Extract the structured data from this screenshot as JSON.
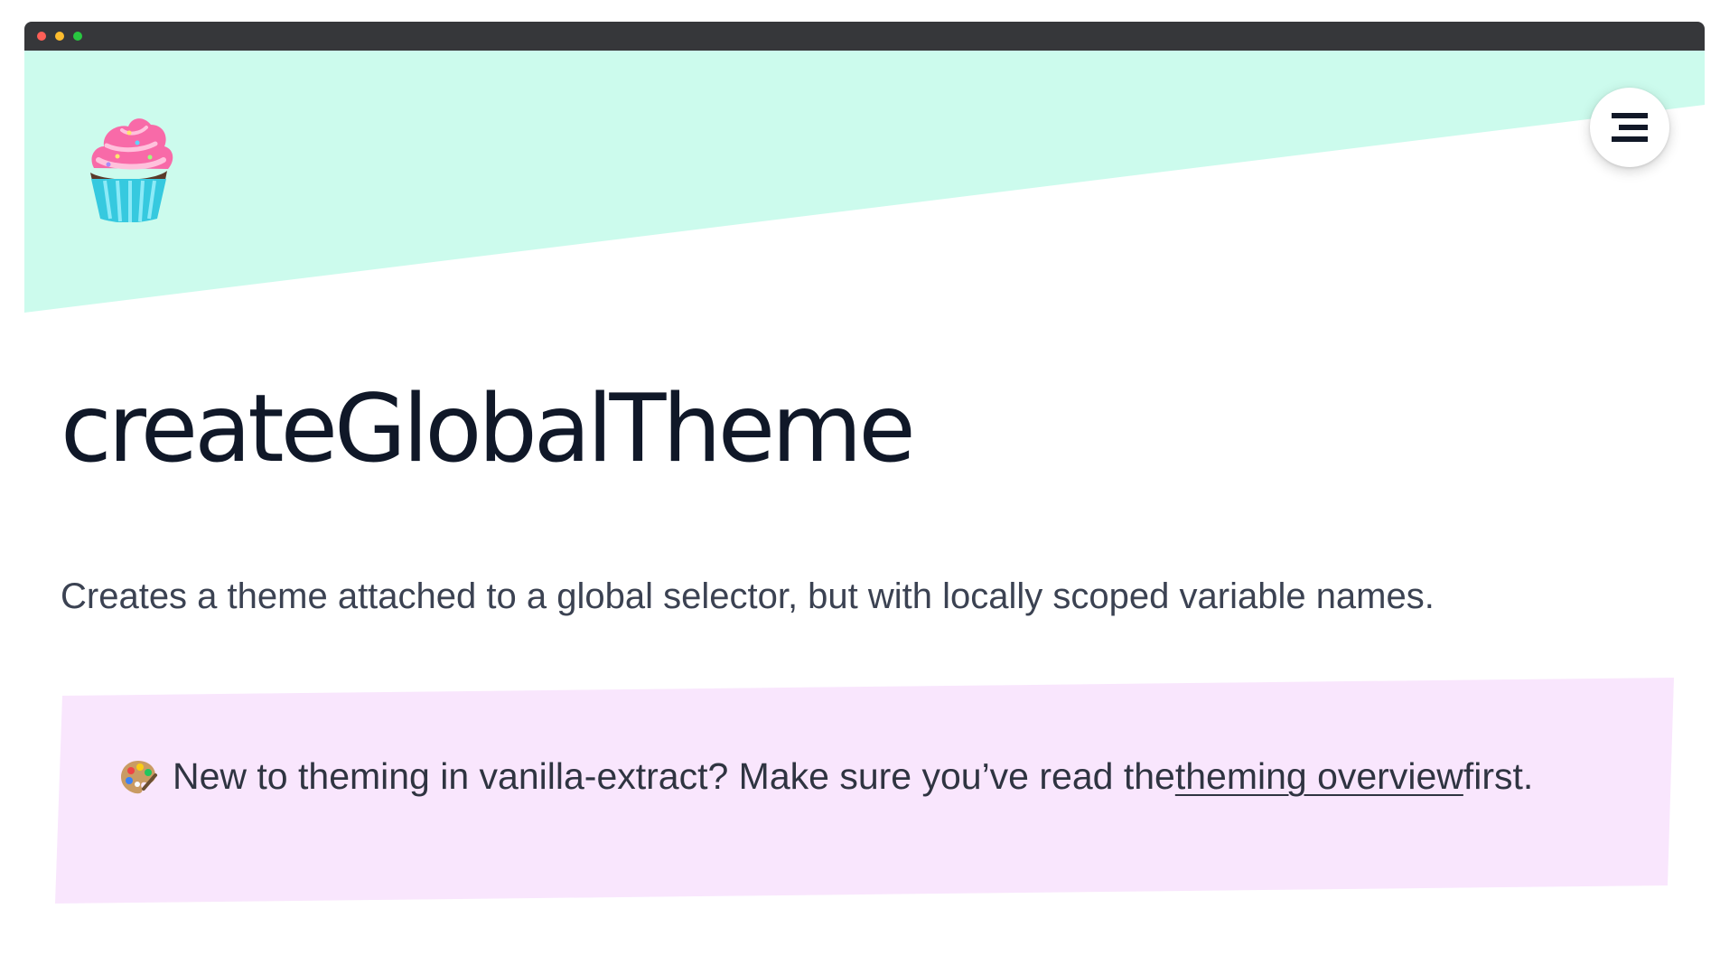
{
  "colors": {
    "titlebar": "#36373a",
    "hero": "#ccfbed",
    "callout": "#f9e6fd",
    "title_text": "#101828",
    "body_text": "#3b4252",
    "traffic_red": "#ff5f57",
    "traffic_yellow": "#febc2e",
    "traffic_green": "#28c840"
  },
  "icons": {
    "logo": "cupcake-icon",
    "menu": "hamburger-menu-icon",
    "callout": "artist-palette-icon"
  },
  "page": {
    "title": "createGlobalTheme",
    "description": "Creates a theme attached to a global selector, but with locally scoped variable names."
  },
  "callout": {
    "prefix": "New to theming in vanilla-extract? Make sure you’ve read the ",
    "link_label": "theming overview",
    "suffix": " first."
  }
}
